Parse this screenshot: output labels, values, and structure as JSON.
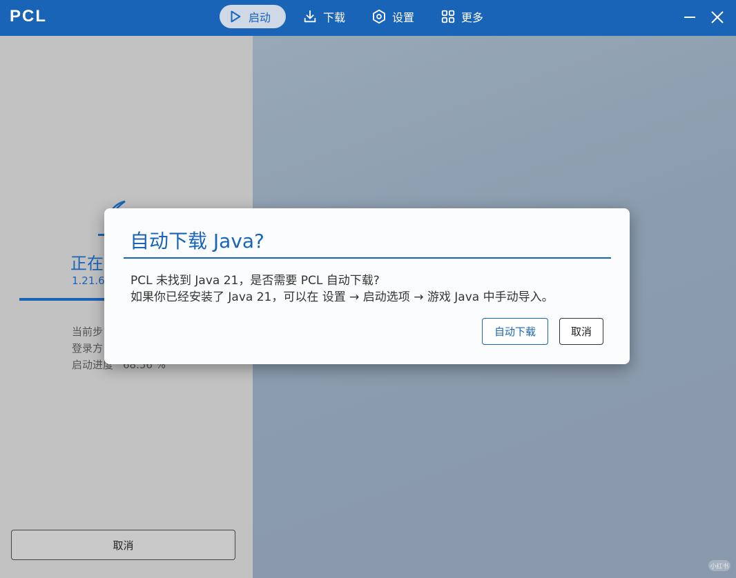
{
  "app": {
    "logo": "PCL"
  },
  "nav": {
    "items": [
      {
        "label": "启动",
        "icon": "play-icon",
        "active": true
      },
      {
        "label": "下载",
        "icon": "download-icon",
        "active": false
      },
      {
        "label": "设置",
        "icon": "settings-icon",
        "active": false
      },
      {
        "label": "更多",
        "icon": "grid-icon",
        "active": false
      }
    ]
  },
  "launch": {
    "title_visible": "正在",
    "version_visible": "1.21.6-",
    "progress": 0.6856,
    "info": [
      {
        "label": "当前步",
        "value": ""
      },
      {
        "label": "登录方",
        "value": ""
      },
      {
        "label": "启动进度",
        "value": "68.56 %"
      }
    ],
    "cancel_label": "取消"
  },
  "dialog": {
    "title": "自动下载 Java?",
    "message_line1": "PCL 未找到 Java 21，是否需要 PCL 自动下载?",
    "message_line2": "如果你已经安装了 Java 21，可以在 设置 → 启动选项 → 游戏 Java 中手动导入。",
    "confirm_label": "自动下载",
    "cancel_label": "取消"
  },
  "colors": {
    "accent": "#1a64b8",
    "titlebar": "#1a64b8"
  }
}
